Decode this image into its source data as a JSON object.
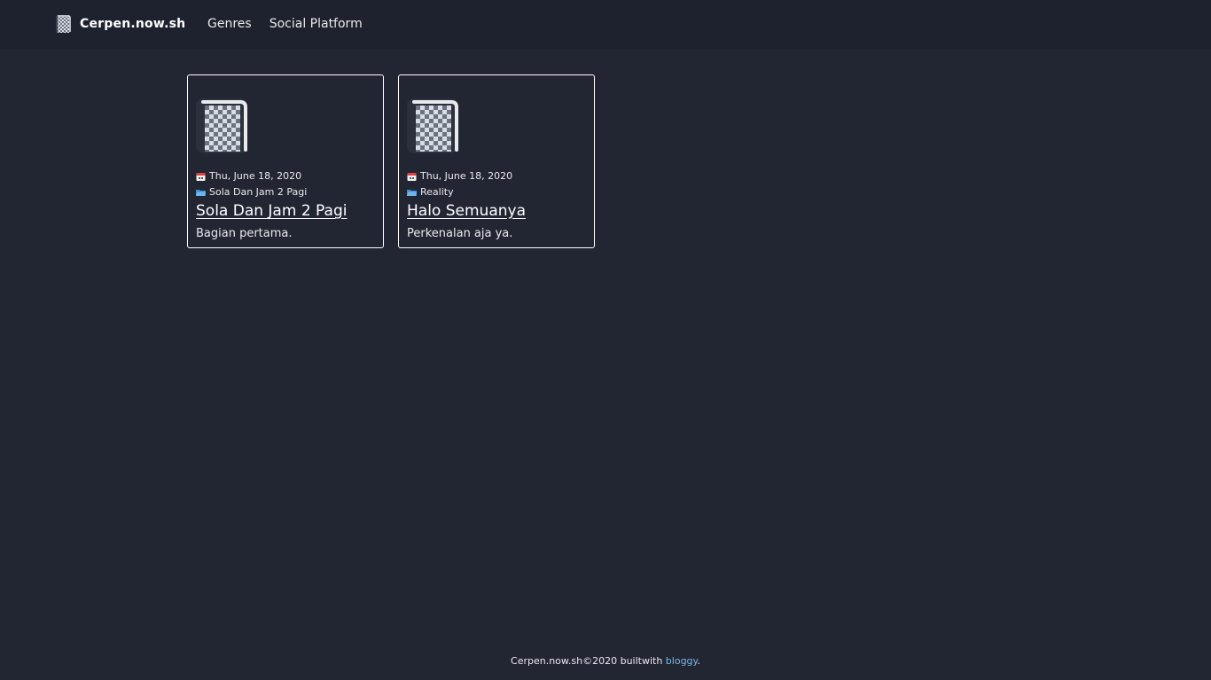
{
  "header": {
    "brand_name": "Cerpen.now.sh",
    "brand_icon": "book-icon",
    "nav": [
      {
        "label": "Genres"
      },
      {
        "label": "Social Platform"
      }
    ]
  },
  "posts": [
    {
      "thumb_icon": "book-icon",
      "date": "Thu, June 18, 2020",
      "date_icon": "calendar-icon",
      "genre": "Sola Dan Jam 2 Pagi",
      "genre_icon": "folder-icon",
      "title": "Sola Dan Jam 2 Pagi",
      "excerpt": "Bagian pertama."
    },
    {
      "thumb_icon": "book-icon",
      "date": "Thu, June 18, 2020",
      "date_icon": "calendar-icon",
      "genre": "Reality",
      "genre_icon": "folder-icon",
      "title": "Halo Semuanya",
      "excerpt": "Perkenalan aja ya."
    }
  ],
  "footer": {
    "text_before": "Cerpen.now.sh©2020 builtwith ",
    "link_label": "bloggy",
    "text_after": "."
  },
  "colors": {
    "background": "#222633",
    "navbar": "#1e222e",
    "text": "#e8eaee",
    "link_accent": "#79b8e8",
    "card_border": "#ffffff"
  }
}
